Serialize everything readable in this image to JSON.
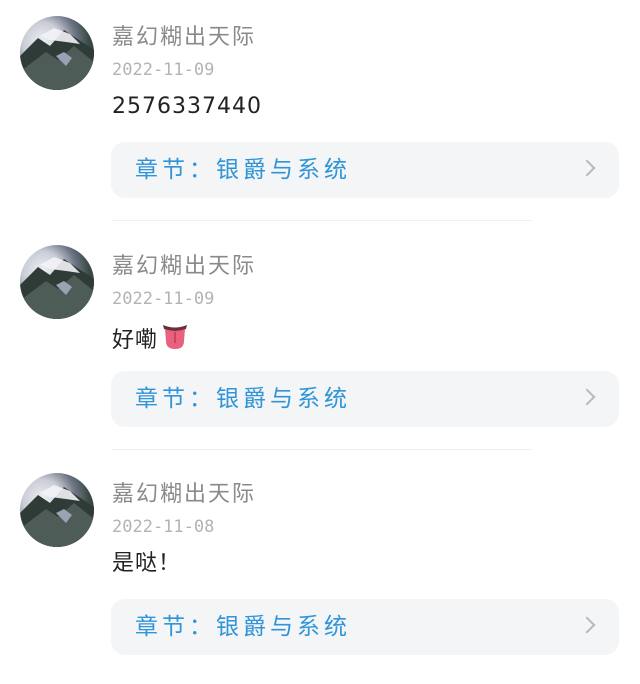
{
  "comments": [
    {
      "username": "嘉幻糊出天际",
      "date": "2022-11-09",
      "content": "2576337440",
      "emoji": "",
      "chapter_label": "章节：银爵与系统"
    },
    {
      "username": "嘉幻糊出天际",
      "date": "2022-11-09",
      "content": "好嘞",
      "emoji": "tongue-emoji",
      "chapter_label": "章节：银爵与系统"
    },
    {
      "username": "嘉幻糊出天际",
      "date": "2022-11-08",
      "content": "是哒！",
      "emoji": "",
      "chapter_label": "章节：银爵与系统"
    }
  ],
  "icons": {
    "avatar": "avatar-image",
    "chevron": "chevron-right-icon"
  },
  "colors": {
    "username": "#8a8a8a",
    "date": "#b3b3b3",
    "content": "#222222",
    "chapter_link": "#2f94d8",
    "chapter_bg": "#f4f5f7"
  }
}
